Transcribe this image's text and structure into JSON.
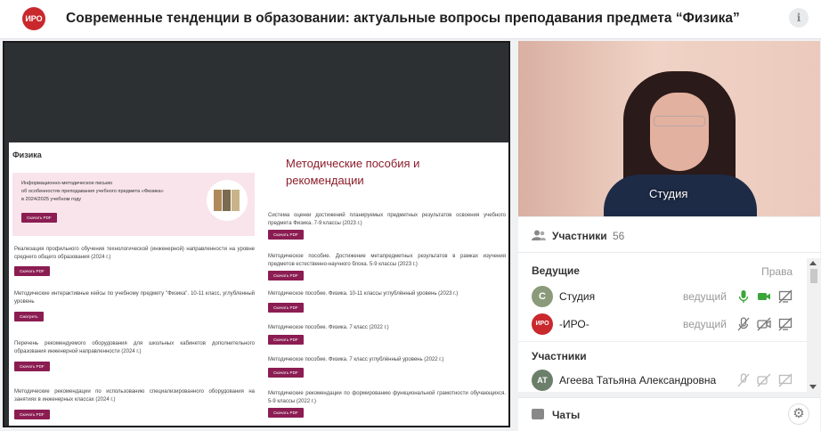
{
  "header": {
    "logo_text": "ИРО",
    "title": "Современные тенденции в образовании: актуальные вопросы преподавания предмета “Физика”"
  },
  "shared_screen": {
    "left": {
      "section_title": "Физика",
      "banner": {
        "line1": "Информационно-методическое письмо",
        "line2": "об особенностях преподавания учебного предмета «Физика»",
        "line3": "в 2024/2025 учебном году",
        "button": "Скачать PDF"
      },
      "items": [
        {
          "text": "Реализация профильного обучения технологической (инженерной) направленности на уровне среднего общего образования (2024 г.)",
          "button": "Скачать PDF"
        },
        {
          "text": "Методические интерактивные кейсы по учебному предмету \"Физика\". 10-11 класс, углубленный уровень",
          "button": "Смотреть"
        },
        {
          "text": "Перечень рекомендуемого оборудования для школьных кабинетов дополнительного образования инженерной направленности (2024 г.)",
          "button": "Скачать PDF"
        },
        {
          "text": "Методические рекомендации по использованию специализированного оборудования на занятиях в инженерных классах (2024 г.)",
          "button": "Скачать PDF"
        }
      ]
    },
    "right": {
      "heading": "Методические пособия и рекомендации",
      "items": [
        {
          "text": "Система оценки достижений планируемых предметных результатов освоения учебного предмета Физика. 7-9 классы (2023 г.)",
          "button": "Скачать PDF"
        },
        {
          "text": "Методическое пособие. Достижение метапредметных результатов в рамках изучения предметов естественно-научного блока. 5-9 классы (2023 г.)",
          "button": "Скачать PDF"
        },
        {
          "text": "Методическое пособие. Физика. 10-11 классы углублённый уровень (2023 г.)",
          "button": "Скачать PDF"
        },
        {
          "text": "Методическое пособие. Физика. 7 класс (2022 г.)",
          "button": "Скачать PDF"
        },
        {
          "text": "Методическое пособие. Физика. 7 класс углублённый уровень (2022 г.)",
          "button": "Скачать PDF"
        },
        {
          "text": "Методические рекомендации по формированию функциональной грамотности обучающихся. 5-9 классы (2022 г.)",
          "button": "Скачать PDF"
        }
      ]
    }
  },
  "video": {
    "name": "Студия"
  },
  "participants": {
    "title": "Участники",
    "count": "56",
    "hosts_label": "Ведущие",
    "rights_label": "Права",
    "hosts": [
      {
        "initial": "С",
        "name": "Студия",
        "role": "ведущий",
        "avatar_color": "#8a9a7a",
        "mic": "on",
        "cam": "on"
      },
      {
        "initial": "ИРО",
        "name": "-ИРО-",
        "role": "ведущий",
        "avatar_color": "#c9282d",
        "mic": "off",
        "cam": "off"
      }
    ],
    "participants_label": "Участники",
    "list": [
      {
        "initial": "АТ",
        "name": "Агеева Татьяна Александровна",
        "avatar_color": "#6b7f6a"
      }
    ]
  },
  "chats": {
    "title": "Чаты"
  },
  "colors": {
    "accent": "#8b1d52",
    "brand": "#c9282d",
    "mic_on": "#3aa63a"
  }
}
